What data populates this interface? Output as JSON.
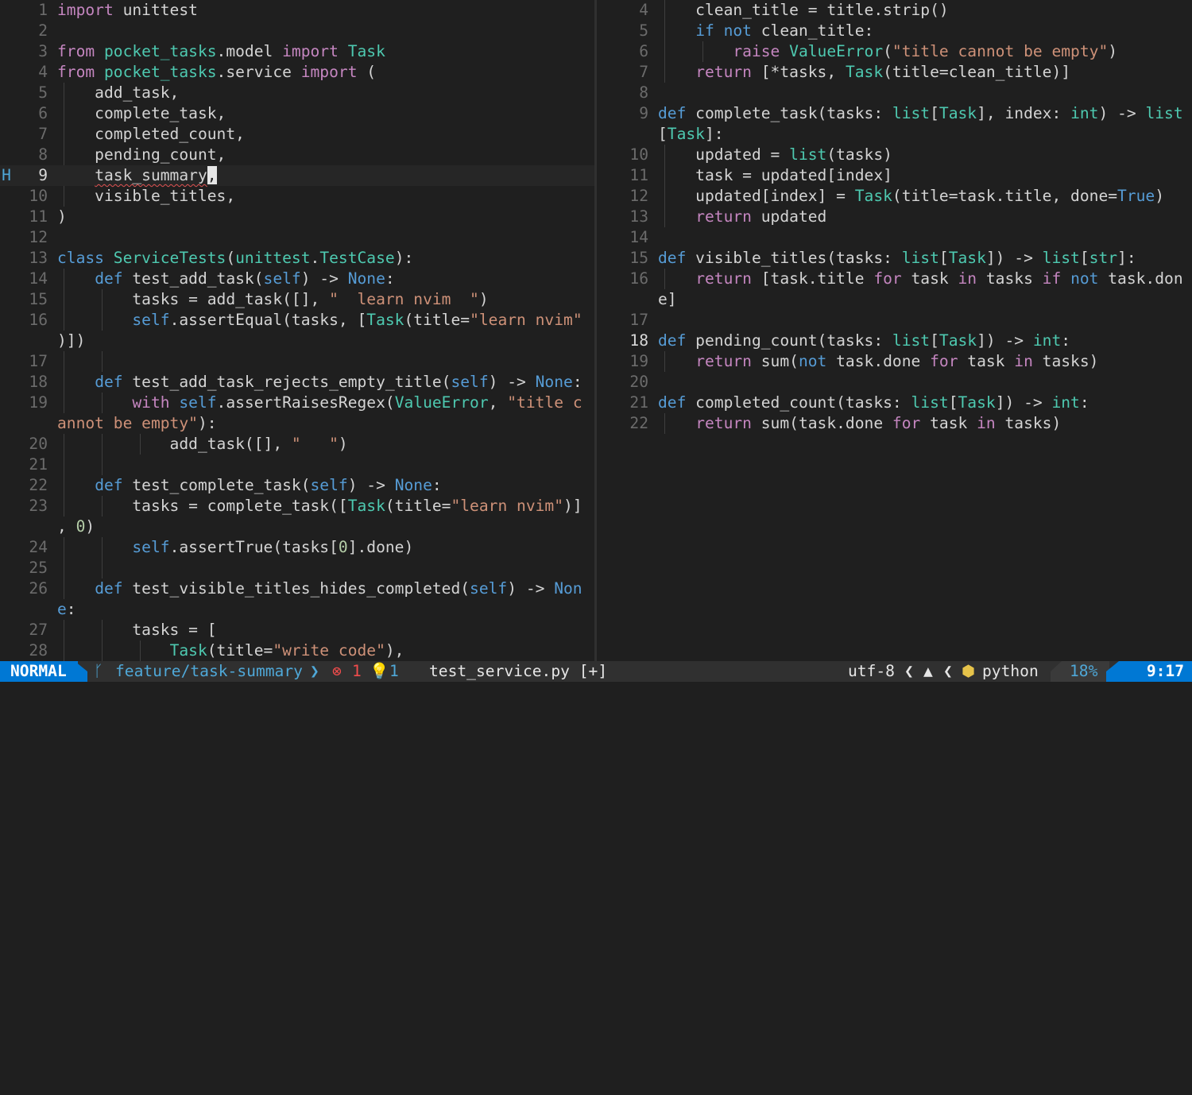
{
  "left": {
    "cursor_line": 9,
    "sign_text": "H",
    "lines": [
      {
        "n": "1",
        "g": [],
        "t": [
          [
            "kw",
            "import"
          ],
          [
            "",
            " "
          ],
          [
            "",
            "unittest"
          ]
        ]
      },
      {
        "n": "2",
        "g": [],
        "t": []
      },
      {
        "n": "3",
        "g": [],
        "t": [
          [
            "kw",
            "from"
          ],
          [
            "",
            " "
          ],
          [
            "tp",
            "pocket_tasks"
          ],
          [
            "",
            ".model "
          ],
          [
            "kw",
            "import"
          ],
          [
            "",
            " "
          ],
          [
            "tp",
            "Task"
          ]
        ]
      },
      {
        "n": "4",
        "g": [],
        "t": [
          [
            "kw",
            "from"
          ],
          [
            "",
            " "
          ],
          [
            "tp",
            "pocket_tasks"
          ],
          [
            "",
            ".service "
          ],
          [
            "kw",
            "import"
          ],
          [
            "",
            " ("
          ]
        ]
      },
      {
        "n": "5",
        "g": [
          0
        ],
        "t": [
          [
            "",
            "    add_task,"
          ]
        ]
      },
      {
        "n": "6",
        "g": [
          0
        ],
        "t": [
          [
            "",
            "    complete_task,"
          ]
        ]
      },
      {
        "n": "7",
        "g": [
          0
        ],
        "t": [
          [
            "",
            "    completed_count,"
          ]
        ]
      },
      {
        "n": "8",
        "g": [
          0
        ],
        "t": [
          [
            "",
            "    pending_count,"
          ]
        ]
      },
      {
        "n": "9",
        "g": [],
        "t": [
          [
            "",
            "    "
          ],
          [
            "undercurl",
            "task_summary"
          ],
          [
            "cursor-block",
            ","
          ]
        ]
      },
      {
        "n": "10",
        "g": [
          0
        ],
        "t": [
          [
            "",
            "    visible_titles,"
          ]
        ]
      },
      {
        "n": "11",
        "g": [],
        "t": [
          [
            "",
            ")"
          ]
        ]
      },
      {
        "n": "12",
        "g": [],
        "t": []
      },
      {
        "n": "13",
        "g": [],
        "t": [
          [
            "kb",
            "class"
          ],
          [
            "",
            " "
          ],
          [
            "tp",
            "ServiceTests"
          ],
          [
            "",
            "("
          ],
          [
            "tp",
            "unittest"
          ],
          [
            "",
            "."
          ],
          [
            "tp",
            "TestCase"
          ],
          [
            "",
            "):"
          ]
        ]
      },
      {
        "n": "14",
        "g": [
          0
        ],
        "t": [
          [
            "",
            "    "
          ],
          [
            "kb",
            "def"
          ],
          [
            "",
            " test_add_task("
          ],
          [
            "sf",
            "self"
          ],
          [
            "",
            ") -> "
          ],
          [
            "kb",
            "None"
          ],
          [
            "",
            ":"
          ]
        ]
      },
      {
        "n": "15",
        "g": [
          0,
          1
        ],
        "t": [
          [
            "",
            "        tasks = add_task([], "
          ],
          [
            "st",
            "\"  learn nvim  \""
          ],
          [
            "",
            ")"
          ]
        ]
      },
      {
        "n": "16",
        "g": [
          0,
          1
        ],
        "t": [
          [
            "",
            "        "
          ],
          [
            "sf",
            "self"
          ],
          [
            "",
            ".assertEqual(tasks, ["
          ],
          [
            "tp",
            "Task"
          ],
          [
            "",
            "(title="
          ],
          [
            "st",
            "\"learn nvim\""
          ]
        ]
      },
      {
        "n": "",
        "g": [],
        "t": [
          [
            "",
            ")])"
          ]
        ]
      },
      {
        "n": "17",
        "g": [
          0,
          1
        ],
        "t": []
      },
      {
        "n": "18",
        "g": [
          0
        ],
        "t": [
          [
            "",
            "    "
          ],
          [
            "kb",
            "def"
          ],
          [
            "",
            " test_add_task_rejects_empty_title("
          ],
          [
            "sf",
            "self"
          ],
          [
            "",
            ") -> "
          ],
          [
            "kb",
            "None"
          ],
          [
            "",
            ":"
          ]
        ]
      },
      {
        "n": "19",
        "g": [
          0,
          1
        ],
        "t": [
          [
            "",
            "        "
          ],
          [
            "kw",
            "with"
          ],
          [
            "",
            " "
          ],
          [
            "sf",
            "self"
          ],
          [
            "",
            ".assertRaisesRegex("
          ],
          [
            "tp",
            "ValueError"
          ],
          [
            "",
            ", "
          ],
          [
            "st",
            "\"title c"
          ]
        ]
      },
      {
        "n": "",
        "g": [],
        "t": [
          [
            "st",
            "annot be empty\""
          ],
          [
            "",
            "):"
          ]
        ]
      },
      {
        "n": "20",
        "g": [
          0,
          1,
          2
        ],
        "t": [
          [
            "",
            "            add_task([], "
          ],
          [
            "st",
            "\"   \""
          ],
          [
            "",
            ")"
          ]
        ]
      },
      {
        "n": "21",
        "g": [
          0,
          1
        ],
        "t": []
      },
      {
        "n": "22",
        "g": [
          0
        ],
        "t": [
          [
            "",
            "    "
          ],
          [
            "kb",
            "def"
          ],
          [
            "",
            " test_complete_task("
          ],
          [
            "sf",
            "self"
          ],
          [
            "",
            ") -> "
          ],
          [
            "kb",
            "None"
          ],
          [
            "",
            ":"
          ]
        ]
      },
      {
        "n": "23",
        "g": [
          0,
          1
        ],
        "t": [
          [
            "",
            "        tasks = complete_task(["
          ],
          [
            "tp",
            "Task"
          ],
          [
            "",
            "(title="
          ],
          [
            "st",
            "\"learn nvim\""
          ],
          [
            "",
            ")]"
          ]
        ]
      },
      {
        "n": "",
        "g": [],
        "t": [
          [
            "",
            ", "
          ],
          [
            "num",
            "0"
          ],
          [
            "",
            ")"
          ]
        ]
      },
      {
        "n": "24",
        "g": [
          0,
          1
        ],
        "t": [
          [
            "",
            "        "
          ],
          [
            "sf",
            "self"
          ],
          [
            "",
            ".assertTrue(tasks["
          ],
          [
            "num",
            "0"
          ],
          [
            "",
            "].done)"
          ]
        ]
      },
      {
        "n": "25",
        "g": [
          0,
          1
        ],
        "t": []
      },
      {
        "n": "26",
        "g": [
          0
        ],
        "t": [
          [
            "",
            "    "
          ],
          [
            "kb",
            "def"
          ],
          [
            "",
            " test_visible_titles_hides_completed("
          ],
          [
            "sf",
            "self"
          ],
          [
            "",
            ") -> "
          ],
          [
            "kb",
            "Non"
          ]
        ]
      },
      {
        "n": "",
        "g": [],
        "t": [
          [
            "kb",
            "e"
          ],
          [
            "",
            ":"
          ]
        ]
      },
      {
        "n": "27",
        "g": [
          0,
          1
        ],
        "t": [
          [
            "",
            "        tasks = ["
          ]
        ]
      },
      {
        "n": "28",
        "g": [
          0,
          1,
          2
        ],
        "t": [
          [
            "",
            "            "
          ],
          [
            "tp",
            "Task"
          ],
          [
            "",
            "(title="
          ],
          [
            "st",
            "\"write code\""
          ],
          [
            "",
            "),"
          ]
        ]
      }
    ]
  },
  "right": {
    "cursor_line": 18,
    "lines": [
      {
        "n": "4",
        "g": [
          0
        ],
        "t": [
          [
            "",
            "    clean_title = title.strip()"
          ]
        ]
      },
      {
        "n": "5",
        "g": [
          0
        ],
        "t": [
          [
            "",
            "    "
          ],
          [
            "kb",
            "if"
          ],
          [
            "",
            " "
          ],
          [
            "kb",
            "not"
          ],
          [
            "",
            " clean_title:"
          ]
        ]
      },
      {
        "n": "6",
        "g": [
          0,
          1
        ],
        "t": [
          [
            "",
            "        "
          ],
          [
            "kw",
            "raise"
          ],
          [
            "",
            " "
          ],
          [
            "tp",
            "ValueError"
          ],
          [
            "",
            "("
          ],
          [
            "st",
            "\"title cannot be empty\""
          ],
          [
            "",
            ")"
          ]
        ]
      },
      {
        "n": "7",
        "g": [
          0
        ],
        "t": [
          [
            "",
            "    "
          ],
          [
            "kw",
            "return"
          ],
          [
            "",
            " [*tasks, "
          ],
          [
            "tp",
            "Task"
          ],
          [
            "",
            "(title=clean_title)]"
          ]
        ]
      },
      {
        "n": "8",
        "g": [],
        "t": []
      },
      {
        "n": "9",
        "g": [],
        "t": [
          [
            "kb",
            "def"
          ],
          [
            "",
            " complete_task(tasks: "
          ],
          [
            "bi",
            "list"
          ],
          [
            "",
            "["
          ],
          [
            "tp",
            "Task"
          ],
          [
            "",
            "], index: "
          ],
          [
            "bi",
            "int"
          ],
          [
            "",
            ") -> "
          ],
          [
            "bi",
            "list"
          ]
        ]
      },
      {
        "n": "",
        "g": [],
        "t": [
          [
            "",
            "["
          ],
          [
            "tp",
            "Task"
          ],
          [
            "",
            "]:"
          ]
        ]
      },
      {
        "n": "10",
        "g": [
          0
        ],
        "t": [
          [
            "",
            "    updated = "
          ],
          [
            "bi",
            "list"
          ],
          [
            "",
            "(tasks)"
          ]
        ]
      },
      {
        "n": "11",
        "g": [
          0
        ],
        "t": [
          [
            "",
            "    task = updated[index]"
          ]
        ]
      },
      {
        "n": "12",
        "g": [
          0
        ],
        "t": [
          [
            "",
            "    updated[index] = "
          ],
          [
            "tp",
            "Task"
          ],
          [
            "",
            "(title=task.title, done="
          ],
          [
            "kb",
            "True"
          ],
          [
            "",
            ")"
          ]
        ]
      },
      {
        "n": "13",
        "g": [
          0
        ],
        "t": [
          [
            "",
            "    "
          ],
          [
            "kw",
            "return"
          ],
          [
            "",
            " updated"
          ]
        ]
      },
      {
        "n": "14",
        "g": [],
        "t": []
      },
      {
        "n": "15",
        "g": [],
        "t": [
          [
            "kb",
            "def"
          ],
          [
            "",
            " visible_titles(tasks: "
          ],
          [
            "bi",
            "list"
          ],
          [
            "",
            "["
          ],
          [
            "tp",
            "Task"
          ],
          [
            "",
            "]) -> "
          ],
          [
            "bi",
            "list"
          ],
          [
            "",
            "["
          ],
          [
            "bi",
            "str"
          ],
          [
            "",
            "]:"
          ]
        ]
      },
      {
        "n": "16",
        "g": [
          0
        ],
        "t": [
          [
            "",
            "    "
          ],
          [
            "kw",
            "return"
          ],
          [
            "",
            " [task.title "
          ],
          [
            "kw",
            "for"
          ],
          [
            "",
            " task "
          ],
          [
            "kw",
            "in"
          ],
          [
            "",
            " tasks "
          ],
          [
            "kw",
            "if"
          ],
          [
            "",
            " "
          ],
          [
            "kb",
            "not"
          ],
          [
            "",
            " task.don"
          ]
        ]
      },
      {
        "n": "",
        "g": [],
        "t": [
          [
            "",
            "e]"
          ]
        ]
      },
      {
        "n": "17",
        "g": [],
        "t": []
      },
      {
        "n": "18",
        "g": [],
        "t": [
          [
            "kb",
            "def"
          ],
          [
            "",
            " pending_count(tasks: "
          ],
          [
            "bi",
            "list"
          ],
          [
            "",
            "["
          ],
          [
            "tp",
            "Task"
          ],
          [
            "",
            "]) -> "
          ],
          [
            "bi",
            "int"
          ],
          [
            "",
            ":"
          ]
        ]
      },
      {
        "n": "19",
        "g": [
          0
        ],
        "t": [
          [
            "",
            "    "
          ],
          [
            "kw",
            "return"
          ],
          [
            "",
            " sum("
          ],
          [
            "kb",
            "not"
          ],
          [
            "",
            " task.done "
          ],
          [
            "kw",
            "for"
          ],
          [
            "",
            " task "
          ],
          [
            "kw",
            "in"
          ],
          [
            "",
            " tasks)"
          ]
        ]
      },
      {
        "n": "20",
        "g": [],
        "t": []
      },
      {
        "n": "21",
        "g": [],
        "t": [
          [
            "kb",
            "def"
          ],
          [
            "",
            " completed_count(tasks: "
          ],
          [
            "bi",
            "list"
          ],
          [
            "",
            "["
          ],
          [
            "tp",
            "Task"
          ],
          [
            "",
            "]) -> "
          ],
          [
            "bi",
            "int"
          ],
          [
            "",
            ":"
          ]
        ]
      },
      {
        "n": "22",
        "g": [
          0
        ],
        "t": [
          [
            "",
            "    "
          ],
          [
            "kw",
            "return"
          ],
          [
            "",
            " sum(task.done "
          ],
          [
            "kw",
            "for"
          ],
          [
            "",
            " task "
          ],
          [
            "kw",
            "in"
          ],
          [
            "",
            " tasks)"
          ]
        ]
      }
    ]
  },
  "statusline": {
    "mode": "NORMAL",
    "branch_icon": "git-branch-icon",
    "branch": "feature/task-summary",
    "separator": "❯",
    "error_count": "1",
    "hint_count": "1",
    "file": "test_service.py [+]",
    "encoding": "utf-8",
    "os_icon": "linux-icon",
    "filetype_icon": "python-icon",
    "filetype": "python",
    "progress": "18%",
    "position": "9:17"
  },
  "colors": {
    "background": "#1f1f1f",
    "mode_bg": "#0078d4",
    "accent": "#4fa8d8",
    "error": "#f14c4c"
  }
}
